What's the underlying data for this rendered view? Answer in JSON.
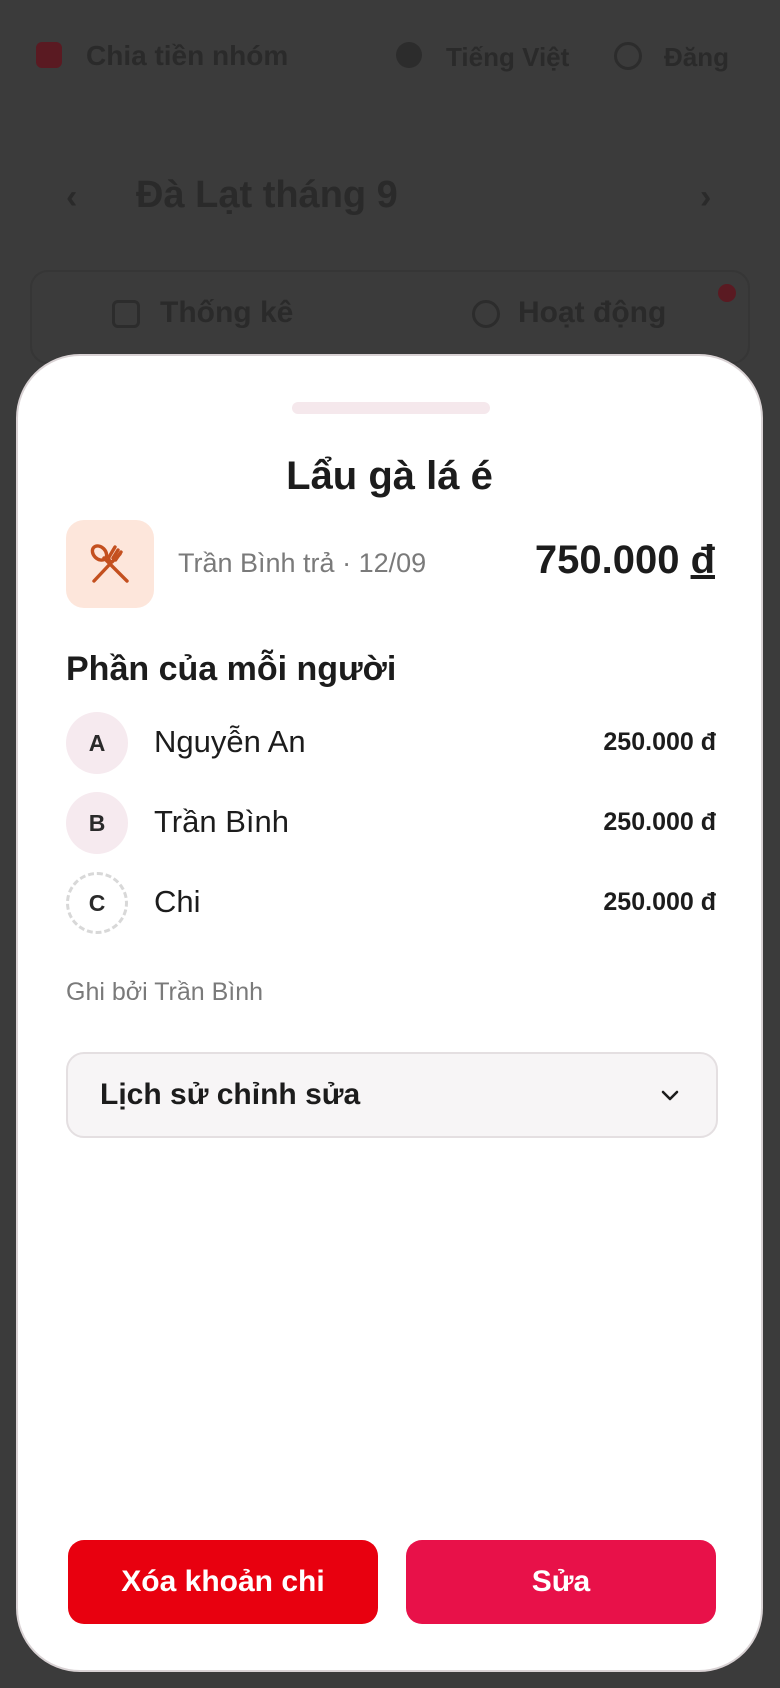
{
  "background": {
    "app_title": "Chia tiền nhóm",
    "language_label": "Tiếng Việt",
    "user_label": "Đăng",
    "group_title": "Đà Lạt tháng 9",
    "tabs": [
      {
        "label": "Thống kê"
      },
      {
        "label": "Hoạt động"
      }
    ]
  },
  "expense": {
    "title": "Lẩu gà lá é",
    "category_icon": "fork-knife-icon",
    "payer_line": "Trần Bình trả · 12/09",
    "amount_value": "750.000",
    "currency": "đ"
  },
  "shares": {
    "section_title": "Phần của mỗi người",
    "people": [
      {
        "initial": "A",
        "name": "Nguyễn An",
        "amount": "250.000 đ",
        "dashed": false
      },
      {
        "initial": "B",
        "name": "Trần Bình",
        "amount": "250.000 đ",
        "dashed": false
      },
      {
        "initial": "C",
        "name": "Chi",
        "amount": "250.000 đ",
        "dashed": true
      }
    ]
  },
  "recorded_by": "Ghi bởi Trần Bình",
  "history": {
    "label": "Lịch sử chỉnh sửa"
  },
  "actions": {
    "delete_label": "Xóa khoản chi",
    "edit_label": "Sửa"
  },
  "colors": {
    "delete_button": "#e8000f",
    "edit_button": "#e81149",
    "category_bg": "#fde6db",
    "category_icon": "#c4501f"
  }
}
